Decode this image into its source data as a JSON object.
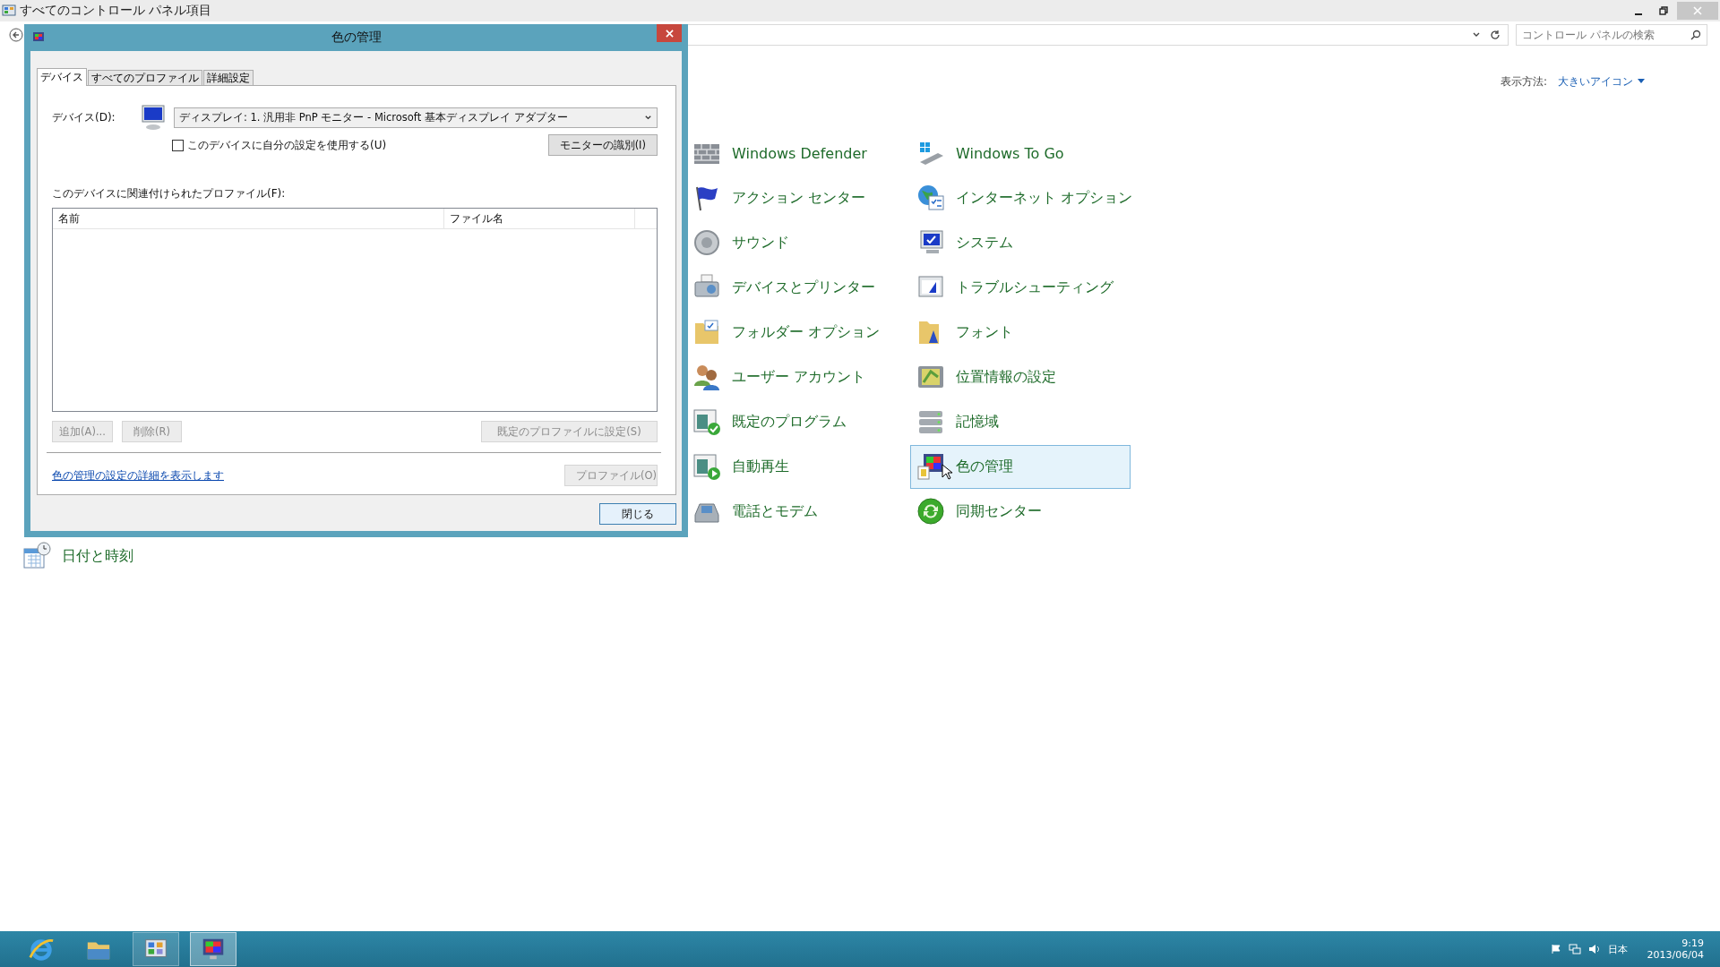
{
  "window": {
    "title": "すべてのコントロール パネル項目"
  },
  "address_bar": {
    "search_placeholder": "コントロール パネルの検索"
  },
  "view_by": {
    "label": "表示方法:",
    "value": "大きいアイコン"
  },
  "items": [
    {
      "label": "Windows Defender",
      "selected": false
    },
    {
      "label": "Windows To Go",
      "selected": false
    },
    {
      "label": "アクション センター",
      "selected": false
    },
    {
      "label": "インターネット オプション",
      "selected": false
    },
    {
      "label": "サウンド",
      "selected": false
    },
    {
      "label": "システム",
      "selected": false
    },
    {
      "label": "デバイスとプリンター",
      "selected": false
    },
    {
      "label": "トラブルシューティング",
      "selected": false
    },
    {
      "label": "フォルダー オプション",
      "selected": false
    },
    {
      "label": "フォント",
      "selected": false
    },
    {
      "label": "ユーザー アカウント",
      "selected": false
    },
    {
      "label": "位置情報の設定",
      "selected": false
    },
    {
      "label": "既定のプログラム",
      "selected": false
    },
    {
      "label": "記憶域",
      "selected": false
    },
    {
      "label": "自動再生",
      "selected": false
    },
    {
      "label": "色の管理",
      "selected": true
    },
    {
      "label": "電話とモデム",
      "selected": false
    },
    {
      "label": "同期センター",
      "selected": false
    }
  ],
  "partly_hidden_items": [
    {
      "label": "日付と時刻"
    }
  ],
  "dialog": {
    "title": "色の管理",
    "tabs": [
      {
        "label": "デバイス",
        "selected": true
      },
      {
        "label": "すべてのプロファイル",
        "selected": false
      },
      {
        "label": "詳細設定",
        "selected": false
      }
    ],
    "device_label": "デバイス(D):",
    "device_value": "ディスプレイ: 1. 汎用非 PnP モニター - Microsoft 基本ディスプレイ アダプター",
    "use_my_settings": {
      "label": "このデバイスに自分の設定を使用する(U)",
      "checked": false
    },
    "identify_button": "モニターの識別(I)",
    "profiles_label": "このデバイスに関連付けられたプロファイル(F):",
    "columns": [
      "名前",
      "ファイル名"
    ],
    "list_buttons": [
      {
        "label": "追加(A)...",
        "disabled": true
      },
      {
        "label": "削除(R)",
        "disabled": true
      },
      {
        "label": "既定のプロファイルに設定(S)",
        "disabled": true
      }
    ],
    "link": "色の管理の設定の詳細を表示します",
    "profiles_button": {
      "label": "プロファイル(O)",
      "disabled": true
    },
    "close_button": "閉じる"
  },
  "taskbar": {
    "apps": [
      {
        "running": false,
        "selected": false
      },
      {
        "running": false,
        "selected": false
      },
      {
        "running": true,
        "selected": false
      },
      {
        "running": true,
        "selected": true
      }
    ],
    "language": "日本",
    "time": "9:19",
    "date": "2013/06/04"
  }
}
